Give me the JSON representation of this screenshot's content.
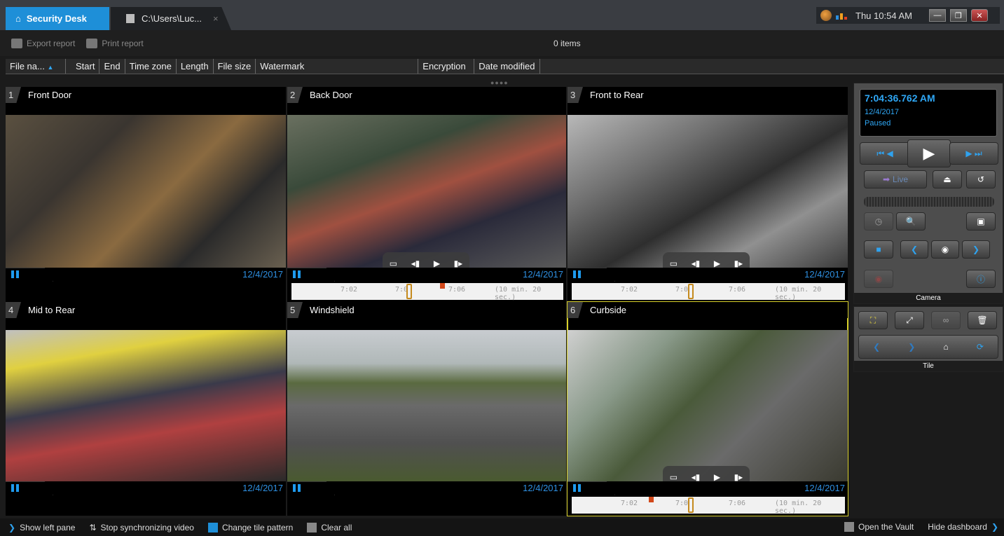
{
  "tabs": {
    "home_label": "Security Desk",
    "file_label": "C:\\Users\\Luc...",
    "file_close": "×"
  },
  "tray": {
    "time": "Thu 10:54 AM"
  },
  "toolbar": {
    "export_label": "Export report",
    "print_label": "Print report",
    "items_count": "0 items"
  },
  "columns": [
    "File na...",
    "Start",
    "End",
    "Time zone",
    "Length",
    "File size",
    "Watermark",
    "Encryption",
    "Date modified"
  ],
  "tiles": [
    {
      "num": "1",
      "name": "Front Door",
      "date": "12/4/2017"
    },
    {
      "num": "2",
      "name": "Back Door",
      "date": "12/4/2017"
    },
    {
      "num": "3",
      "name": "Front to Rear",
      "date": "12/4/2017"
    },
    {
      "num": "4",
      "name": "Mid to Rear",
      "date": "12/4/2017"
    },
    {
      "num": "5",
      "name": "Windshield",
      "date": "12/4/2017"
    },
    {
      "num": "6",
      "name": "Curbside",
      "date": "12/4/2017"
    }
  ],
  "timeline": {
    "t1": "7:02",
    "t2": "7:0",
    "t3": "7:06",
    "duration": "(10 min. 20 sec.)"
  },
  "dashboard": {
    "time": "7:04:36.762 AM",
    "date": "12/4/2017",
    "status": "Paused",
    "live_label": "Live",
    "camera_label": "Camera",
    "tile_label": "Tile"
  },
  "bottom": {
    "show_left": "Show left pane",
    "stop_sync": "Stop synchronizing video",
    "change_pattern": "Change tile pattern",
    "clear_all": "Clear all",
    "open_vault": "Open the Vault",
    "hide_dashboard": "Hide dashboard"
  },
  "colors": {
    "accent": "#1e8fd8",
    "selected_tile": "#d8d02a",
    "bookmark": "#d2481a"
  }
}
